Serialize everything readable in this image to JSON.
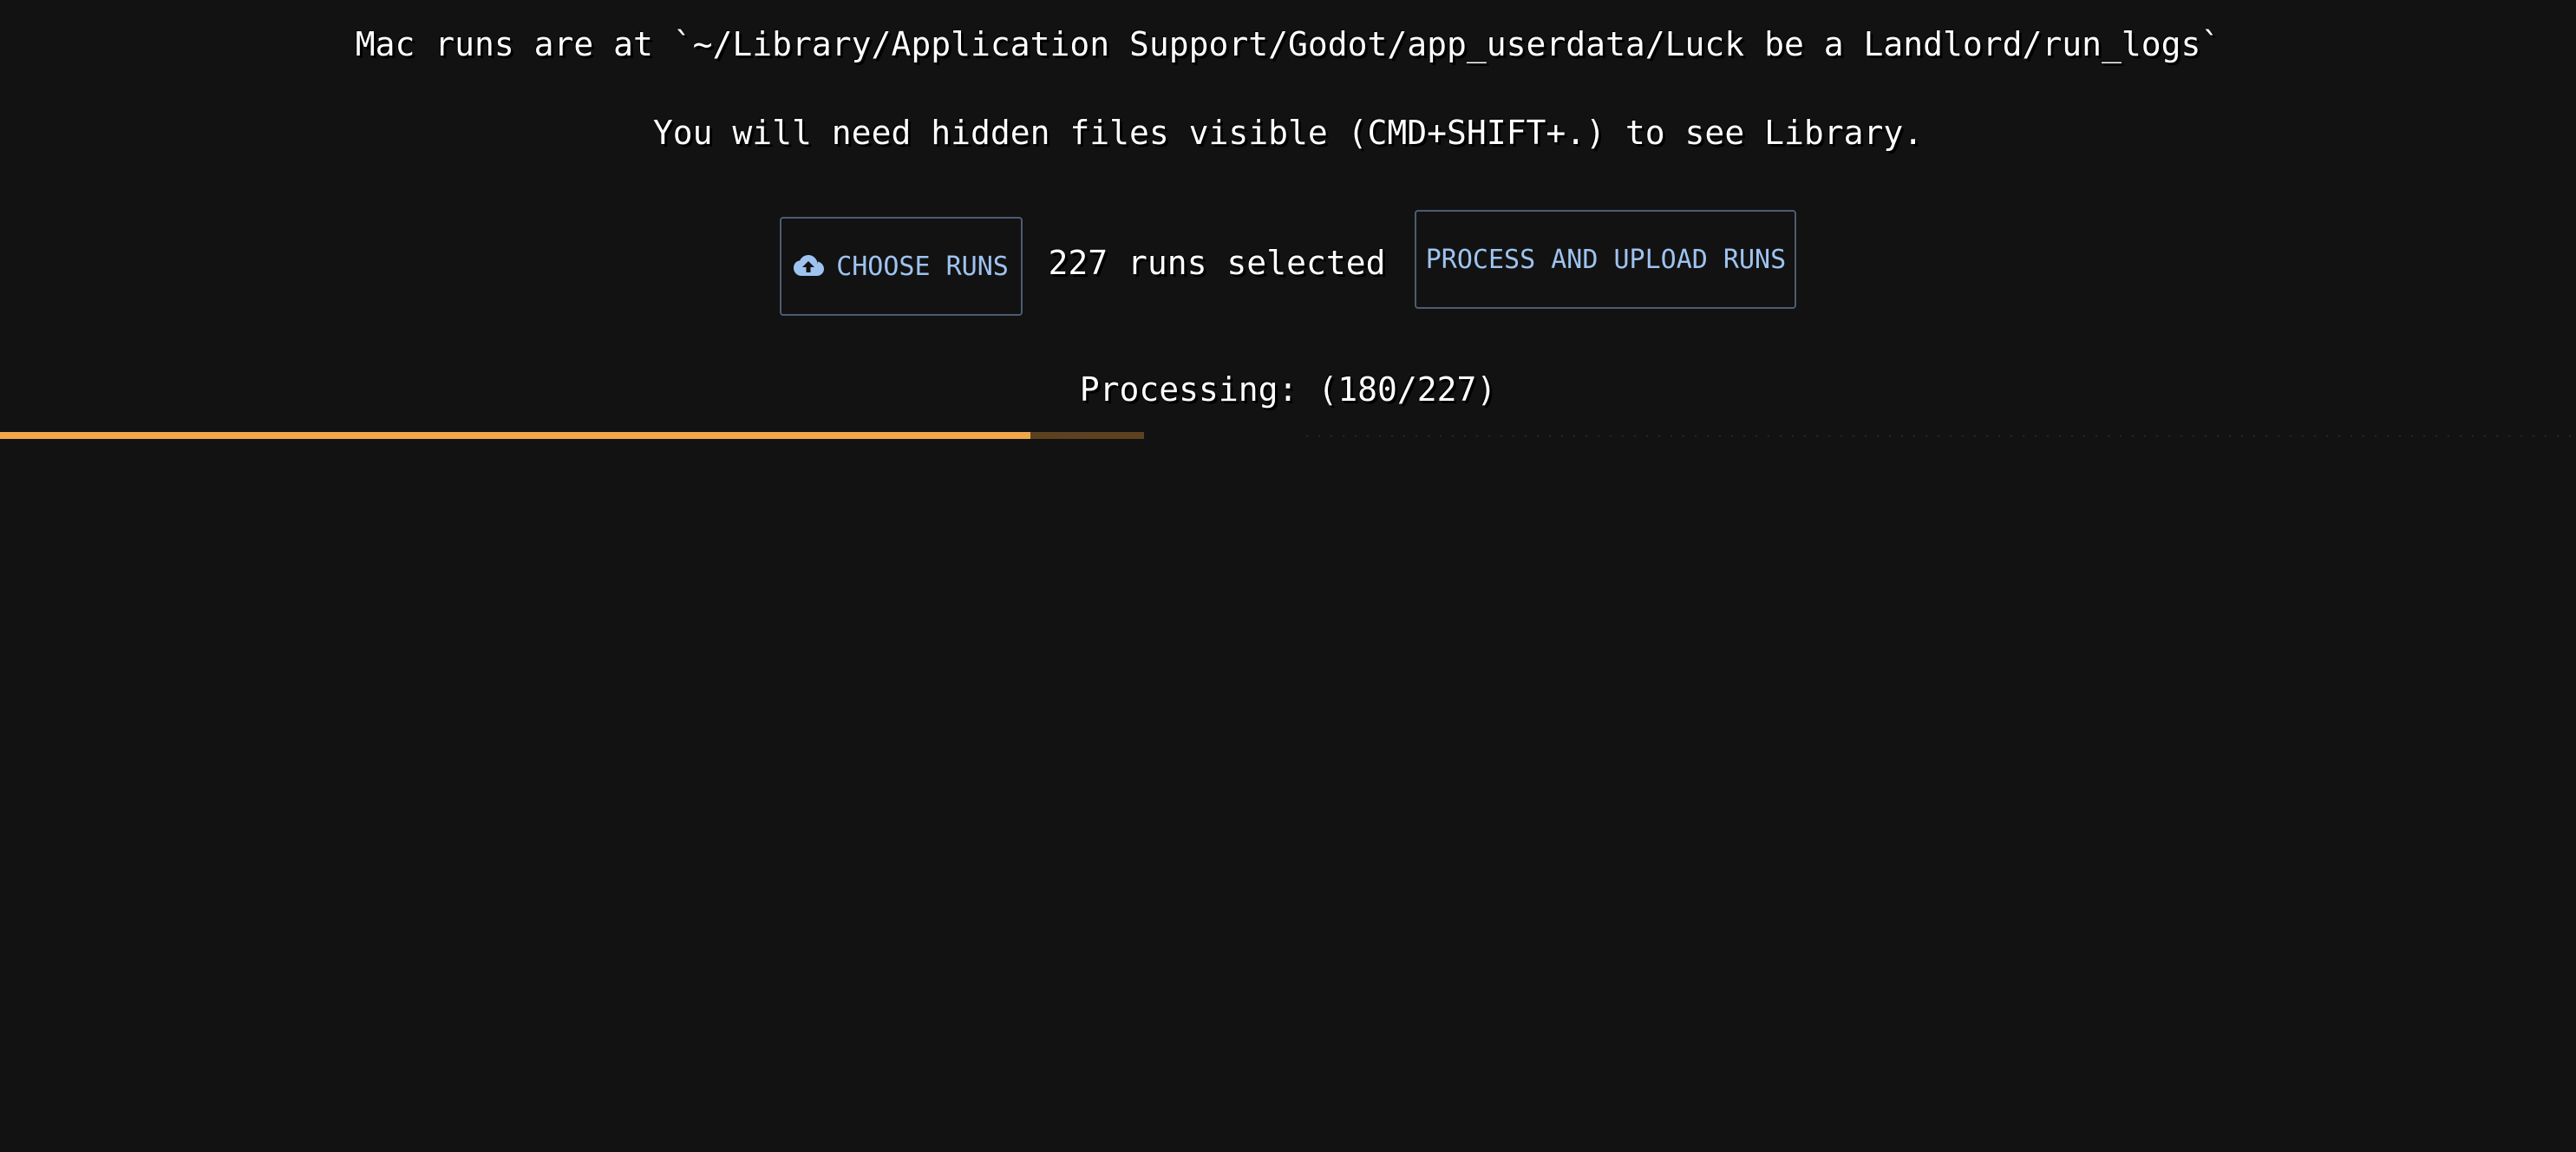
{
  "instructions": {
    "mac_path": "Mac runs are at `~/Library/Application Support/Godot/app_userdata/Luck be a Landlord/run_logs`",
    "hidden_files_hint": "You will need hidden files visible (CMD+SHIFT+.) to see Library."
  },
  "controls": {
    "choose_runs_label": "CHOOSE RUNS",
    "choose_runs_icon": "cloud-upload-icon",
    "selected_count_text": "227 runs selected",
    "process_upload_label": "PROCESS AND UPLOAD RUNS"
  },
  "progress": {
    "status_text": "Processing: (180/227)",
    "processed": 180,
    "total": 227,
    "fill_fraction": 0.4,
    "buffer_fraction": 0.444,
    "fill_color": "#f0a84a",
    "buffer_color": "#5e4220"
  },
  "colors": {
    "background": "#121212",
    "text": "#ffffff",
    "button_text": "#9ec3f0",
    "button_border": "#4c5c70"
  }
}
